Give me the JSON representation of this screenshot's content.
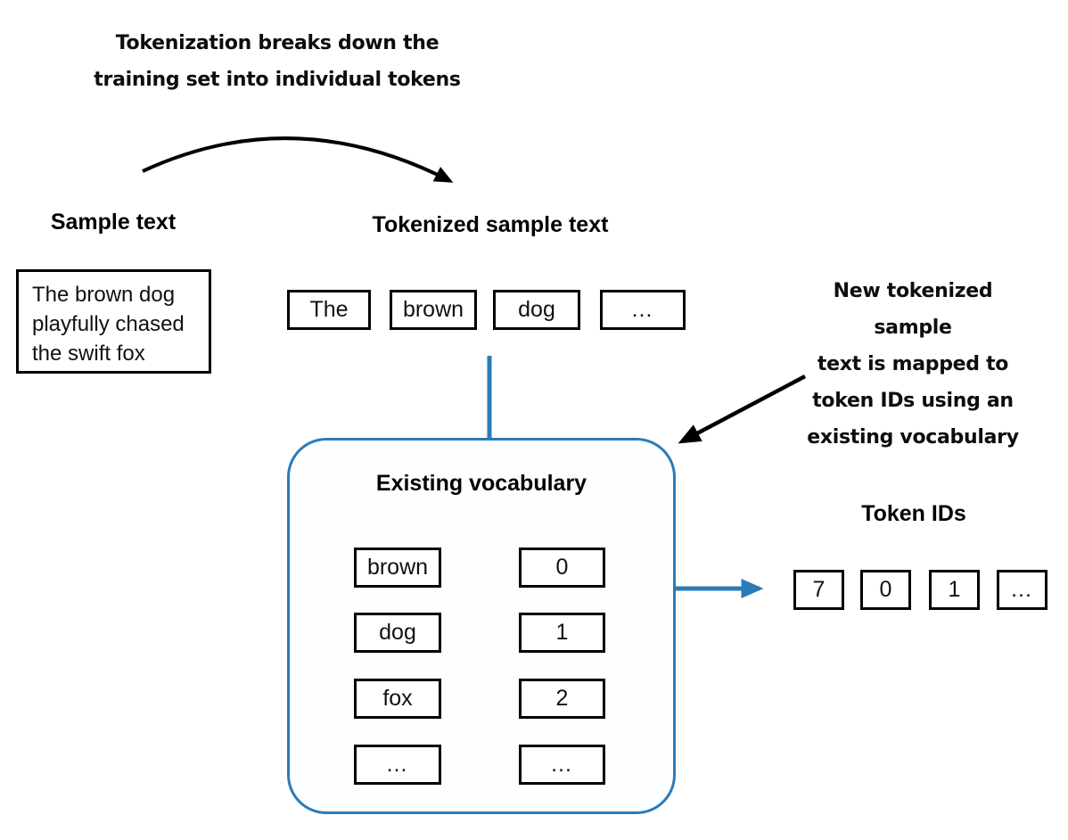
{
  "diagram": {
    "title_note": "Tokenization breaks down the\ntraining set into individual tokens",
    "mapping_note": "New tokenized sample\ntext is mapped to\ntoken IDs using an\nexisting vocabulary"
  },
  "sample": {
    "heading": "Sample text",
    "text": "The brown dog\nplayfully chased\nthe swift fox"
  },
  "tokenized": {
    "heading": "Tokenized sample text",
    "tokens": [
      "The",
      "brown",
      "dog",
      "…"
    ]
  },
  "vocabulary": {
    "heading": "Existing vocabulary",
    "rows": [
      {
        "token": "brown",
        "id": "0"
      },
      {
        "token": "dog",
        "id": "1"
      },
      {
        "token": "fox",
        "id": "2"
      },
      {
        "token": "…",
        "id": "…"
      }
    ]
  },
  "token_ids": {
    "heading": "Token IDs",
    "ids": [
      "7",
      "0",
      "1",
      "…"
    ]
  },
  "colors": {
    "accent_blue": "#2b7bb9",
    "ink": "#000000",
    "panel_fill": "#fdfeff",
    "background": "#ffffff"
  },
  "icons": {
    "curved_arrow": "curved-arrow-icon",
    "diagonal_arrow": "diagonal-arrow-icon",
    "flow_arrow": "flow-arrow-icon",
    "map_arrow": "map-arrow-icon",
    "connector": "connector-line-icon"
  }
}
